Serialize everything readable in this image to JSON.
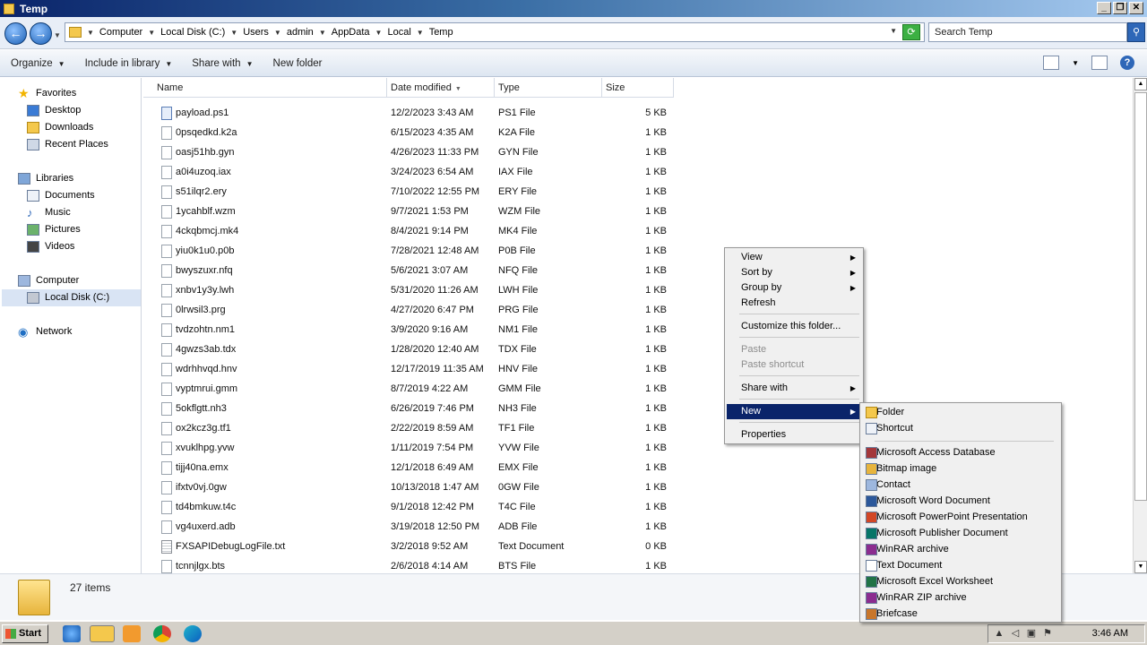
{
  "window": {
    "title": "Temp",
    "buttons": {
      "minimize": "_",
      "restore": "❐",
      "close": "✕"
    }
  },
  "address": {
    "breadcrumbs": [
      "Computer",
      "Local Disk (C:)",
      "Users",
      "admin",
      "AppData",
      "Local",
      "Temp"
    ],
    "search_placeholder": "Search Temp"
  },
  "toolbar": {
    "organize": "Organize",
    "include_in_library": "Include in library",
    "share_with": "Share with",
    "new_folder": "New folder"
  },
  "nav": {
    "favorites": "Favorites",
    "desktop": "Desktop",
    "downloads": "Downloads",
    "recent_places": "Recent Places",
    "libraries": "Libraries",
    "documents": "Documents",
    "music": "Music",
    "pictures": "Pictures",
    "videos": "Videos",
    "computer": "Computer",
    "local_disk": "Local Disk (C:)",
    "network": "Network"
  },
  "columns": {
    "name": "Name",
    "date": "Date modified",
    "type": "Type",
    "size": "Size"
  },
  "files": [
    {
      "name": "payload.ps1",
      "date": "12/2/2023 3:43 AM",
      "type": "PS1 File",
      "size": "5 KB",
      "icon": "ps1-file-icon"
    },
    {
      "name": "0psqedkd.k2a",
      "date": "6/15/2023 4:35 AM",
      "type": "K2A File",
      "size": "1 KB",
      "icon": "file-icon"
    },
    {
      "name": "oasj51hb.gyn",
      "date": "4/26/2023 11:33 PM",
      "type": "GYN File",
      "size": "1 KB",
      "icon": "file-icon"
    },
    {
      "name": "a0i4uzoq.iax",
      "date": "3/24/2023 6:54 AM",
      "type": "IAX File",
      "size": "1 KB",
      "icon": "file-icon"
    },
    {
      "name": "s51ilqr2.ery",
      "date": "7/10/2022 12:55 PM",
      "type": "ERY File",
      "size": "1 KB",
      "icon": "file-icon"
    },
    {
      "name": "1ycahblf.wzm",
      "date": "9/7/2021 1:53 PM",
      "type": "WZM File",
      "size": "1 KB",
      "icon": "file-icon"
    },
    {
      "name": "4ckqbmcj.mk4",
      "date": "8/4/2021 9:14 PM",
      "type": "MK4 File",
      "size": "1 KB",
      "icon": "file-icon"
    },
    {
      "name": "yiu0k1u0.p0b",
      "date": "7/28/2021 12:48 AM",
      "type": "P0B File",
      "size": "1 KB",
      "icon": "file-icon"
    },
    {
      "name": "bwyszuxr.nfq",
      "date": "5/6/2021 3:07 AM",
      "type": "NFQ File",
      "size": "1 KB",
      "icon": "file-icon"
    },
    {
      "name": "xnbv1y3y.lwh",
      "date": "5/31/2020 11:26 AM",
      "type": "LWH File",
      "size": "1 KB",
      "icon": "file-icon"
    },
    {
      "name": "0lrwsil3.prg",
      "date": "4/27/2020 6:47 PM",
      "type": "PRG File",
      "size": "1 KB",
      "icon": "file-icon"
    },
    {
      "name": "tvdzohtn.nm1",
      "date": "3/9/2020 9:16 AM",
      "type": "NM1 File",
      "size": "1 KB",
      "icon": "file-icon"
    },
    {
      "name": "4gwzs3ab.tdx",
      "date": "1/28/2020 12:40 AM",
      "type": "TDX File",
      "size": "1 KB",
      "icon": "file-icon"
    },
    {
      "name": "wdrhhvqd.hnv",
      "date": "12/17/2019 11:35 AM",
      "type": "HNV File",
      "size": "1 KB",
      "icon": "file-icon"
    },
    {
      "name": "vyptmrui.gmm",
      "date": "8/7/2019 4:22 AM",
      "type": "GMM File",
      "size": "1 KB",
      "icon": "file-icon"
    },
    {
      "name": "5okflgtt.nh3",
      "date": "6/26/2019 7:46 PM",
      "type": "NH3 File",
      "size": "1 KB",
      "icon": "file-icon"
    },
    {
      "name": "ox2kcz3g.tf1",
      "date": "2/22/2019 8:59 AM",
      "type": "TF1 File",
      "size": "1 KB",
      "icon": "file-icon"
    },
    {
      "name": "xvuklhpg.yvw",
      "date": "1/11/2019 7:54 PM",
      "type": "YVW File",
      "size": "1 KB",
      "icon": "file-icon"
    },
    {
      "name": "tijj40na.emx",
      "date": "12/1/2018 6:49 AM",
      "type": "EMX File",
      "size": "1 KB",
      "icon": "file-icon"
    },
    {
      "name": "ifxtv0vj.0gw",
      "date": "10/13/2018 1:47 AM",
      "type": "0GW File",
      "size": "1 KB",
      "icon": "file-icon"
    },
    {
      "name": "td4bmkuw.t4c",
      "date": "9/1/2018 12:42 PM",
      "type": "T4C File",
      "size": "1 KB",
      "icon": "file-icon"
    },
    {
      "name": "vg4uxerd.adb",
      "date": "3/19/2018 12:50 PM",
      "type": "ADB File",
      "size": "1 KB",
      "icon": "file-icon"
    },
    {
      "name": "FXSAPIDebugLogFile.txt",
      "date": "3/2/2018 9:52 AM",
      "type": "Text Document",
      "size": "0 KB",
      "icon": "text-file-icon"
    },
    {
      "name": "tcnnjlgx.bts",
      "date": "2/6/2018 4:14 AM",
      "type": "BTS File",
      "size": "1 KB",
      "icon": "file-icon"
    }
  ],
  "status": {
    "item_count": "27 items"
  },
  "context_menu": {
    "view": "View",
    "sort_by": "Sort by",
    "group_by": "Group by",
    "refresh": "Refresh",
    "customize": "Customize this folder...",
    "paste": "Paste",
    "paste_shortcut": "Paste shortcut",
    "share_with": "Share with",
    "new": "New",
    "properties": "Properties"
  },
  "new_submenu": {
    "folder": "Folder",
    "shortcut": "Shortcut",
    "access_db": "Microsoft Access Database",
    "bitmap": "Bitmap image",
    "contact": "Contact",
    "word_doc": "Microsoft Word Document",
    "ppt": "Microsoft PowerPoint Presentation",
    "publisher": "Microsoft Publisher Document",
    "winrar": "WinRAR archive",
    "text_doc": "Text Document",
    "excel": "Microsoft Excel Worksheet",
    "winrar_zip": "WinRAR ZIP archive",
    "briefcase": "Briefcase"
  },
  "taskbar": {
    "start": "Start",
    "clock": "3:46 AM"
  },
  "colors": {
    "menu_highlight": "#0a246a",
    "nav_selected": "#d9e4f4",
    "title_gradient_start": "#0a246a"
  }
}
